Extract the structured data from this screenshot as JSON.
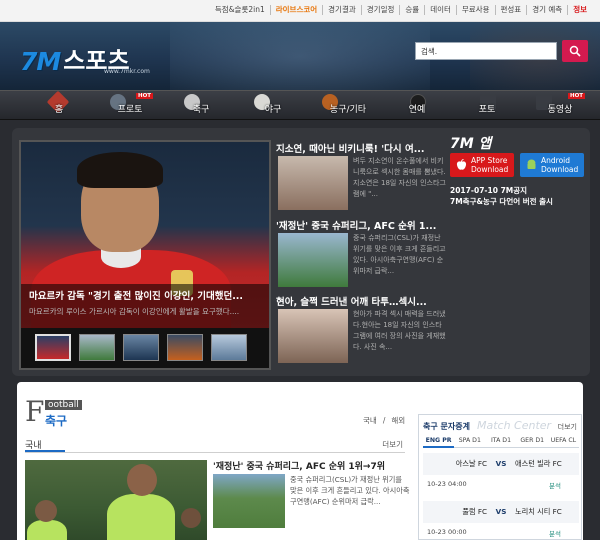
{
  "topbar": {
    "links": [
      "득점&슬롯2in1",
      "라이브스코어",
      "경기결과",
      "경기일정",
      "승률",
      "데이터",
      "무료사용",
      "편성표",
      "경기 예측",
      "정보"
    ]
  },
  "header": {
    "logo_mark": "7M",
    "logo_word": "스포츠",
    "logo_url": "www.7mkr.com",
    "search_label": "검색.",
    "search_value": ""
  },
  "nav": {
    "items": [
      {
        "label": "홈"
      },
      {
        "label": "프로토",
        "hot": "HOT"
      },
      {
        "label": "축구"
      },
      {
        "label": "야구"
      },
      {
        "label": "농구/기타"
      },
      {
        "label": "연예"
      },
      {
        "label": "포토"
      },
      {
        "label": "동영상",
        "hot": "HOT"
      }
    ]
  },
  "feature": {
    "title": "마요르카 감독 \"경기 출전 많이진 이강인, 기대했던...",
    "subtitle": "마요르카의 루이스 가르시아 감독이 이강인에게 활발을 요구했다...."
  },
  "news": [
    {
      "title": "지소연, 때아닌 비키니룩! '다시 여...",
      "desc": "벼두 지소연이 온수풀에서 비키니룩으로 섹시한 몸매를 뽐냈다.지소연은 18일 자신의 인스타그램에 \"..."
    },
    {
      "title": "'재정난' 중국 슈퍼리그, AFC 순위 1...",
      "desc": "중국 슈퍼리그(CSL)가 재정난 위기를 맞은 이후 크게 흔들리고 있다. 아시아축구연맹(AFC) 순위마저 급락..."
    },
    {
      "title": "현아, 슬쩍 드러낸 어깨 타투…섹시...",
      "desc": "현아가 파격 섹시 매력을 드러냈다.현아는 18일 자신의 인스타그램에 여러 장의 사진을 게재했다. 사진 속..."
    }
  ],
  "app": {
    "heading": "7M 앱",
    "appstore_line1": "APP Store",
    "appstore_line2": "Download",
    "android_line1": "Android",
    "android_line2": "Download",
    "note_line1": "2017-07-10 7M공지",
    "note_line2": "7M축구&농구 다언어 버전 출시"
  },
  "football": {
    "big_letter": "F",
    "en": "ootball",
    "ko": "축구",
    "tab_domestic": "국내",
    "tab_sep": "/",
    "tab_overseas": "해외",
    "sub_label": "국내",
    "more": "더보기",
    "story_title": "'재정난' 중국 슈퍼리그, AFC 순위 1위→7위",
    "story_desc": "중국 슈퍼리그(CSL)가 재정난 위기를 맞은 이후 크게 흔들리고 있다. 아시아축구연맹(AFC) 순위마저 급락..."
  },
  "match_center": {
    "title": "축구 문자중계",
    "title_en": "Match Center",
    "more": "더보기",
    "leagues": [
      "ENG PR",
      "SPA D1",
      "ITA D1",
      "GER D1",
      "UEFA CL"
    ],
    "vs_label": "VS",
    "analysis_label": "분석",
    "matches": [
      {
        "home": "아스날 FC",
        "away": "애스턴 빌라 FC",
        "time": ""
      },
      {
        "home": "풀럼 FC",
        "away": "노리치 시티 FC",
        "time": "10-23 04:00"
      }
    ],
    "next_time": "10-23 00:00"
  },
  "colors": {
    "accent_red": "#d8181b",
    "accent_blue": "#1c6ac4",
    "appstore": "#d8181b",
    "android": "#1f7ad4"
  }
}
